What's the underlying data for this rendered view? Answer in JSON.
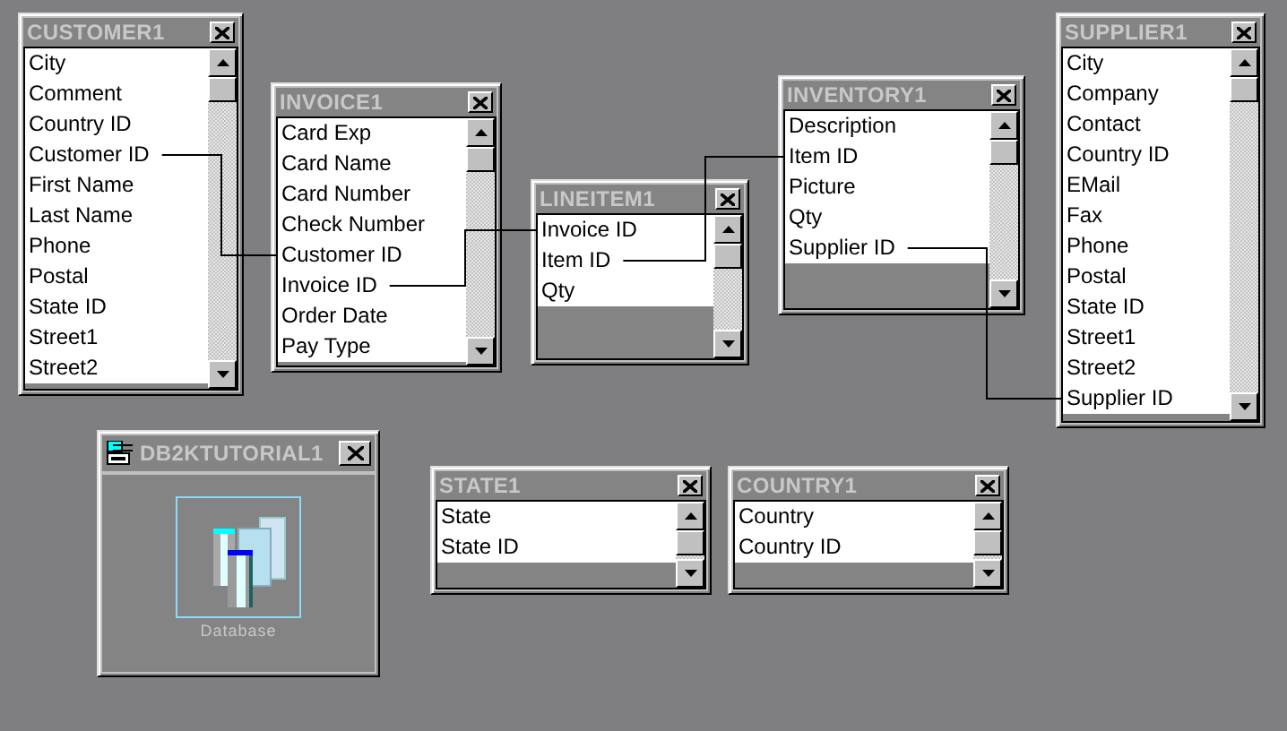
{
  "windows": [
    {
      "kind": "table",
      "title": "CUSTOMER1",
      "fields": [
        "City",
        "Comment",
        "Country ID",
        "Customer ID",
        "First Name",
        "Last Name",
        "Phone",
        "Postal",
        "State ID",
        "Street1",
        "Street2"
      ]
    },
    {
      "kind": "table",
      "title": "INVOICE1",
      "fields": [
        "Card Exp",
        "Card Name",
        "Card Number",
        "Check Number",
        "Customer ID",
        "Invoice ID",
        "Order Date",
        "Pay Type"
      ]
    },
    {
      "kind": "table",
      "title": "LINEITEM1",
      "fields": [
        "Invoice ID",
        "Item ID",
        "Qty"
      ]
    },
    {
      "kind": "table",
      "title": "INVENTORY1",
      "fields": [
        "Description",
        "Item ID",
        "Picture",
        "Qty",
        "Supplier ID"
      ]
    },
    {
      "kind": "table",
      "title": "SUPPLIER1",
      "fields": [
        "City",
        "Company",
        "Contact",
        "Country ID",
        "EMail",
        "Fax",
        "Phone",
        "Postal",
        "State ID",
        "Street1",
        "Street2",
        "Supplier ID"
      ]
    },
    {
      "kind": "database",
      "title": "DB2KTUTORIAL1",
      "item": {
        "label": "Database",
        "selected": true
      }
    },
    {
      "kind": "table",
      "title": "STATE1",
      "fields": [
        "State",
        "State ID"
      ]
    },
    {
      "kind": "table",
      "title": "COUNTRY1",
      "fields": [
        "Country",
        "Country ID"
      ]
    }
  ]
}
